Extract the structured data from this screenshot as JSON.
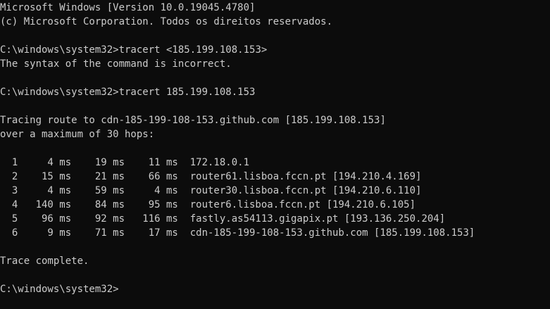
{
  "header": {
    "version_line": "Microsoft Windows [Version 10.0.19045.4780]",
    "copyright_line": "(c) Microsoft Corporation. Todos os direitos reservados."
  },
  "session": {
    "cmd1_prompt": "C:\\windows\\system32>",
    "cmd1_command": "tracert <185.199.108.153>",
    "cmd1_output": "The syntax of the command is incorrect.",
    "cmd2_prompt": "C:\\windows\\system32>",
    "cmd2_command": "tracert 185.199.108.153",
    "tracing_line": "Tracing route to cdn-185-199-108-153.github.com [185.199.108.153]",
    "max_hops_line": "over a maximum of 30 hops:",
    "hops": [
      {
        "text": "  1     4 ms    19 ms    11 ms  172.18.0.1"
      },
      {
        "text": "  2    15 ms    21 ms    66 ms  router61.lisboa.fccn.pt [194.210.4.169]"
      },
      {
        "text": "  3     4 ms    59 ms     4 ms  router30.lisboa.fccn.pt [194.210.6.110]"
      },
      {
        "text": "  4   140 ms    84 ms    95 ms  router6.lisboa.fccn.pt [194.210.6.105]"
      },
      {
        "text": "  5    96 ms    92 ms   116 ms  fastly.as54113.gigapix.pt [193.136.250.204]"
      },
      {
        "text": "  6     9 ms    71 ms    17 ms  cdn-185-199-108-153.github.com [185.199.108.153]"
      }
    ],
    "trace_complete": "Trace complete.",
    "final_prompt": "C:\\windows\\system32>"
  },
  "colors": {
    "background": "#0c0c0c",
    "foreground": "#cccccc"
  }
}
